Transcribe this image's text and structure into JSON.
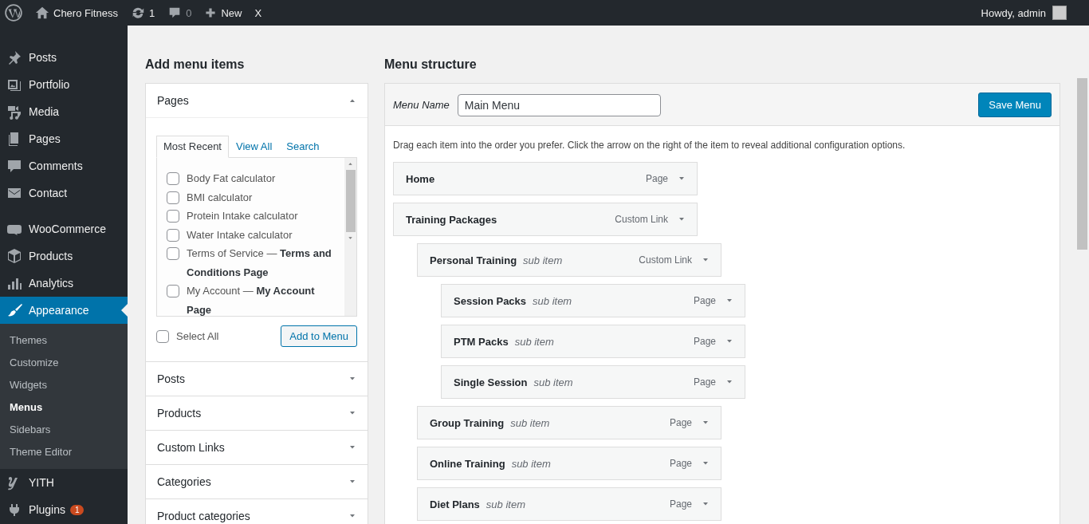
{
  "admin_bar": {
    "site_name": "Chero Fitness",
    "updates": "1",
    "comments": "0",
    "new_label": "New",
    "extra": "X",
    "greeting": "Howdy, admin"
  },
  "sidebar": {
    "items": [
      {
        "label": "Posts",
        "selected": false
      },
      {
        "label": "Portfolio",
        "selected": false
      },
      {
        "label": "Media",
        "selected": false
      },
      {
        "label": "Pages",
        "selected": false
      },
      {
        "label": "Comments",
        "selected": false
      },
      {
        "label": "Contact",
        "selected": false
      },
      {
        "label": "WooCommerce",
        "selected": false
      },
      {
        "label": "Products",
        "selected": false
      },
      {
        "label": "Analytics",
        "selected": false
      },
      {
        "label": "Appearance",
        "selected": true,
        "submenu": [
          {
            "label": "Themes",
            "selected": false
          },
          {
            "label": "Customize",
            "selected": false
          },
          {
            "label": "Widgets",
            "selected": false
          },
          {
            "label": "Menus",
            "selected": true
          },
          {
            "label": "Sidebars",
            "selected": false
          },
          {
            "label": "Theme Editor",
            "selected": false
          }
        ]
      },
      {
        "label": "YITH",
        "selected": false
      },
      {
        "label": "Plugins",
        "selected": false,
        "badge": "1"
      }
    ]
  },
  "add_menu_items": {
    "heading": "Add menu items",
    "pages": {
      "title": "Pages",
      "expanded": true,
      "tabs": [
        {
          "label": "Most Recent",
          "selected": true
        },
        {
          "label": "View All",
          "selected": false
        },
        {
          "label": "Search",
          "selected": false
        }
      ],
      "items": [
        {
          "label": "Body Fat calculator",
          "checked": false
        },
        {
          "label": "BMI calculator",
          "checked": false
        },
        {
          "label": "Protein Intake calculator",
          "checked": false
        },
        {
          "label": "Water Intake calculator",
          "checked": false
        },
        {
          "label": "Terms of Service — **Terms and Conditions Page**",
          "checked": false
        },
        {
          "label": "My Account — **My Account Page**",
          "checked": false
        }
      ],
      "select_all": {
        "label": "Select All",
        "checked": false
      },
      "add_button": "Add to Menu"
    },
    "sections": [
      {
        "title": "Posts",
        "expanded": false
      },
      {
        "title": "Products",
        "expanded": false
      },
      {
        "title": "Custom Links",
        "expanded": false
      },
      {
        "title": "Categories",
        "expanded": false
      },
      {
        "title": "Product categories",
        "expanded": false
      }
    ]
  },
  "menu_structure": {
    "heading": "Menu structure",
    "name_label": "Menu Name",
    "name_value": "Main Menu",
    "save_button": "Save Menu",
    "instructions": "Drag each item into the order you prefer. Click the arrow on the right of the item to reveal additional configuration options.",
    "items": [
      {
        "title": "Home",
        "type": "Page"
      },
      {
        "title": "Training Packages",
        "type": "Custom Link",
        "children": [
          {
            "title": "Personal Training",
            "note": "sub item",
            "type": "Custom Link",
            "children": [
              {
                "title": "Session Packs",
                "note": "sub item",
                "type": "Page"
              },
              {
                "title": "PTM Packs",
                "note": "sub item",
                "type": "Page"
              },
              {
                "title": "Single Session",
                "note": "sub item",
                "type": "Page"
              }
            ]
          },
          {
            "title": "Group Training",
            "note": "sub item",
            "type": "Page"
          },
          {
            "title": "Online Training",
            "note": "sub item",
            "type": "Page"
          },
          {
            "title": "Diet Plans",
            "note": "sub item",
            "type": "Page"
          }
        ]
      }
    ]
  }
}
